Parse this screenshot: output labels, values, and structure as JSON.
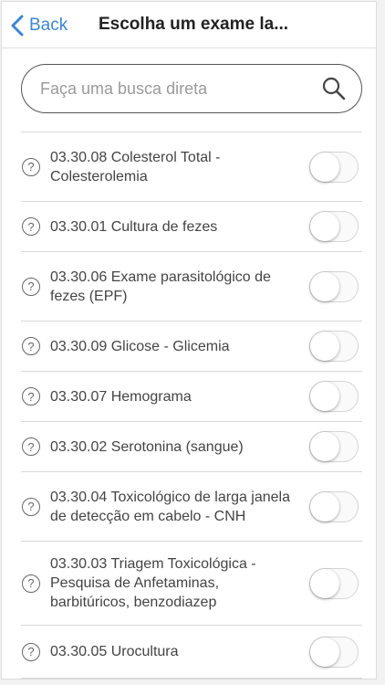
{
  "nav": {
    "back_label": "Back",
    "title": "Escolha um exame la..."
  },
  "search": {
    "placeholder": "Faça uma busca direta",
    "value": ""
  },
  "exams": [
    {
      "label": "03.30.08 Colesterol Total - Colesterolemia",
      "selected": false
    },
    {
      "label": "03.30.01 Cultura de fezes",
      "selected": false
    },
    {
      "label": "03.30.06 Exame parasitológico de fezes (EPF)",
      "selected": false
    },
    {
      "label": "03.30.09 Glicose - Glicemia",
      "selected": false
    },
    {
      "label": "03.30.07 Hemograma",
      "selected": false
    },
    {
      "label": "03.30.02 Serotonina (sangue)",
      "selected": false
    },
    {
      "label": "03.30.04 Toxicológico de larga janela de detecção em cabelo - CNH",
      "selected": false
    },
    {
      "label": "03.30.03 Triagem Toxicológica - Pesquisa de Anfetaminas, barbitúricos, benzodiazep",
      "selected": false
    },
    {
      "label": "03.30.05 Urocultura",
      "selected": false
    }
  ],
  "icons": {
    "back": "chevron-left-icon",
    "search": "search-icon",
    "help": "question-circle-icon"
  },
  "colors": {
    "accent": "#3b86d6"
  }
}
